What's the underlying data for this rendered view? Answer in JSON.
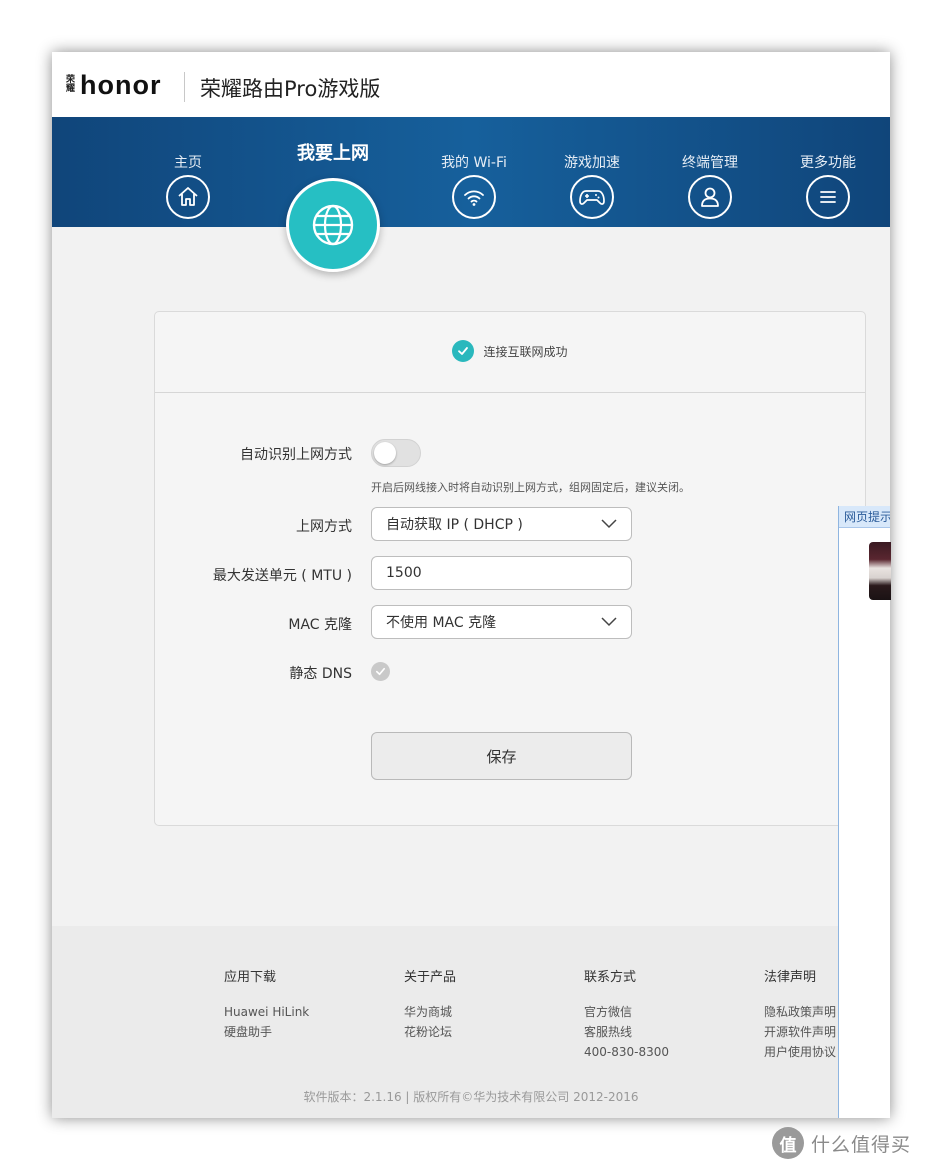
{
  "header": {
    "logo_brand_cn": "荣耀",
    "logo_brand": "honor",
    "product_title": "荣耀路由Pro游戏版"
  },
  "nav": {
    "items": [
      {
        "label": "主页",
        "icon": "home-icon"
      },
      {
        "label": "我要上网",
        "icon": "globe-icon",
        "active": true
      },
      {
        "label": "我的 Wi-Fi",
        "icon": "wifi-icon"
      },
      {
        "label": "游戏加速",
        "icon": "gamepad-icon"
      },
      {
        "label": "终端管理",
        "icon": "user-icon"
      },
      {
        "label": "更多功能",
        "icon": "menu-icon"
      }
    ]
  },
  "status": {
    "text": "连接互联网成功",
    "icon": "check-icon"
  },
  "form": {
    "auto_detect": {
      "label": "自动识别上网方式",
      "enabled": false,
      "hint": "开启后网线接入时将自动识别上网方式，组网固定后，建议关闭。"
    },
    "wan_mode": {
      "label": "上网方式",
      "value": "自动获取 IP ( DHCP )"
    },
    "mtu": {
      "label": "最大发送单元 ( MTU )",
      "value": "1500"
    },
    "mac_clone": {
      "label": "MAC 克隆",
      "value": "不使用 MAC 克隆"
    },
    "static_dns": {
      "label": "静态 DNS",
      "checked": false
    },
    "save_label": "保存"
  },
  "popup": {
    "title": "网页提示"
  },
  "footer": {
    "columns": [
      {
        "title": "应用下载",
        "links": [
          "Huawei HiLink",
          "硬盘助手"
        ]
      },
      {
        "title": "关于产品",
        "links": [
          "华为商城",
          "花粉论坛"
        ]
      },
      {
        "title": "联系方式",
        "links": [
          "官方微信",
          "客服热线",
          "400-830-8300"
        ]
      },
      {
        "title": "法律声明",
        "links": [
          "隐私政策声明",
          "开源软件声明",
          "用户使用协议"
        ]
      }
    ],
    "copyright": "软件版本：2.1.16 | 版权所有©华为技术有限公司 2012-2016"
  },
  "watermark": {
    "glyph": "值",
    "text": "什么值得买"
  },
  "colors": {
    "nav_band": "#16609c",
    "accent_teal": "#26bfc3",
    "brand_red": "#e31d1a"
  }
}
